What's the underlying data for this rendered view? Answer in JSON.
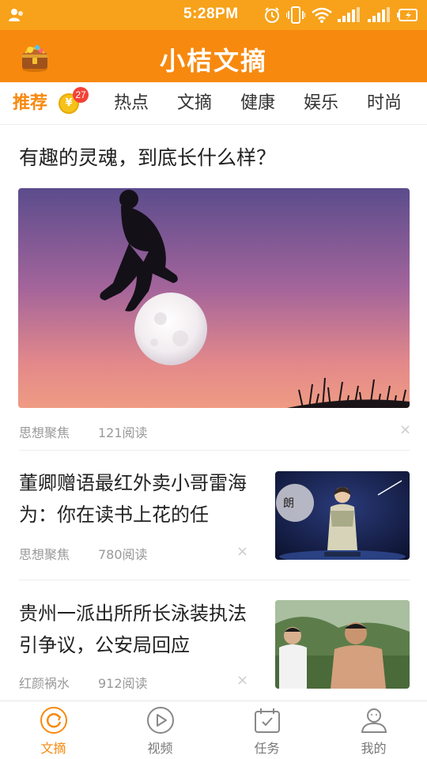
{
  "status_bar": {
    "time": "5:28PM",
    "icons": [
      "user-icon",
      "alarm-icon",
      "vibrate-icon",
      "wifi-icon",
      "signal-icon",
      "signal-icon",
      "battery-icon"
    ]
  },
  "header": {
    "title": "小桔文摘",
    "logo": "treasure-chest-logo"
  },
  "tabs": {
    "items": [
      {
        "label": "推荐",
        "active": true
      },
      {
        "label": "热点",
        "active": false
      },
      {
        "label": "文摘",
        "active": false
      },
      {
        "label": "健康",
        "active": false
      },
      {
        "label": "娱乐",
        "active": false
      },
      {
        "label": "时尚",
        "active": false
      }
    ],
    "coin_symbol": "¥",
    "badge_count": "27"
  },
  "feed": {
    "featured": {
      "title": "有趣的灵魂，到底长什么样？",
      "source": "思想聚焦",
      "reads": "121阅读",
      "image": "silhouette-jumping-over-moon"
    },
    "articles": [
      {
        "title": "董卿赠语最红外卖小哥雷海为：你在读书上花的任",
        "source": "思想聚焦",
        "reads": "780阅读",
        "image": "tv-host-on-stage"
      },
      {
        "title": "贵州一派出所所长泳装执法引争议，公安局回应",
        "source": "红颜祸水",
        "reads": "912阅读",
        "image": "two-men-outdoors"
      }
    ],
    "dismiss_symbol": "×"
  },
  "bottom_nav": {
    "items": [
      {
        "label": "文摘",
        "icon": "refresh-circle-icon",
        "active": true
      },
      {
        "label": "视频",
        "icon": "play-circle-icon",
        "active": false
      },
      {
        "label": "任务",
        "icon": "calendar-check-icon",
        "active": false
      },
      {
        "label": "我的",
        "icon": "person-icon",
        "active": false
      }
    ]
  },
  "colors": {
    "brand_orange": "#f7890f",
    "status_orange": "#f7a21a",
    "badge_red": "#f34237",
    "meta_gray": "#999999"
  }
}
